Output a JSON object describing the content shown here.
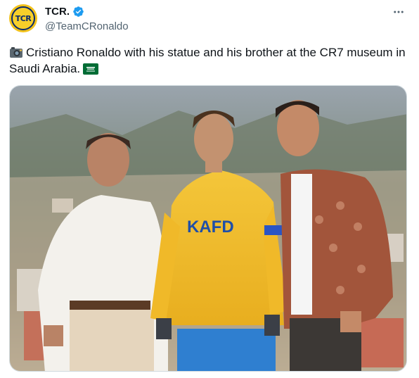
{
  "author": {
    "display_name": "TCR.",
    "handle": "@TeamCRonaldo",
    "avatar_text": "TCR"
  },
  "tweet": {
    "text": "Cristiano Ronaldo with his statue and his brother at the CR7 museum in Saudi Arabia."
  },
  "media": {
    "jersey_text": "KAFD"
  },
  "icons": {
    "verified": "verified-badge-icon",
    "more": "more-options-icon",
    "camera": "camera-emoji-icon",
    "flag": "saudi-flag-icon"
  },
  "colors": {
    "verified_blue": "#1d9bf0",
    "text": "#0f1419",
    "secondary": "#536471",
    "border": "#cfd9de"
  }
}
